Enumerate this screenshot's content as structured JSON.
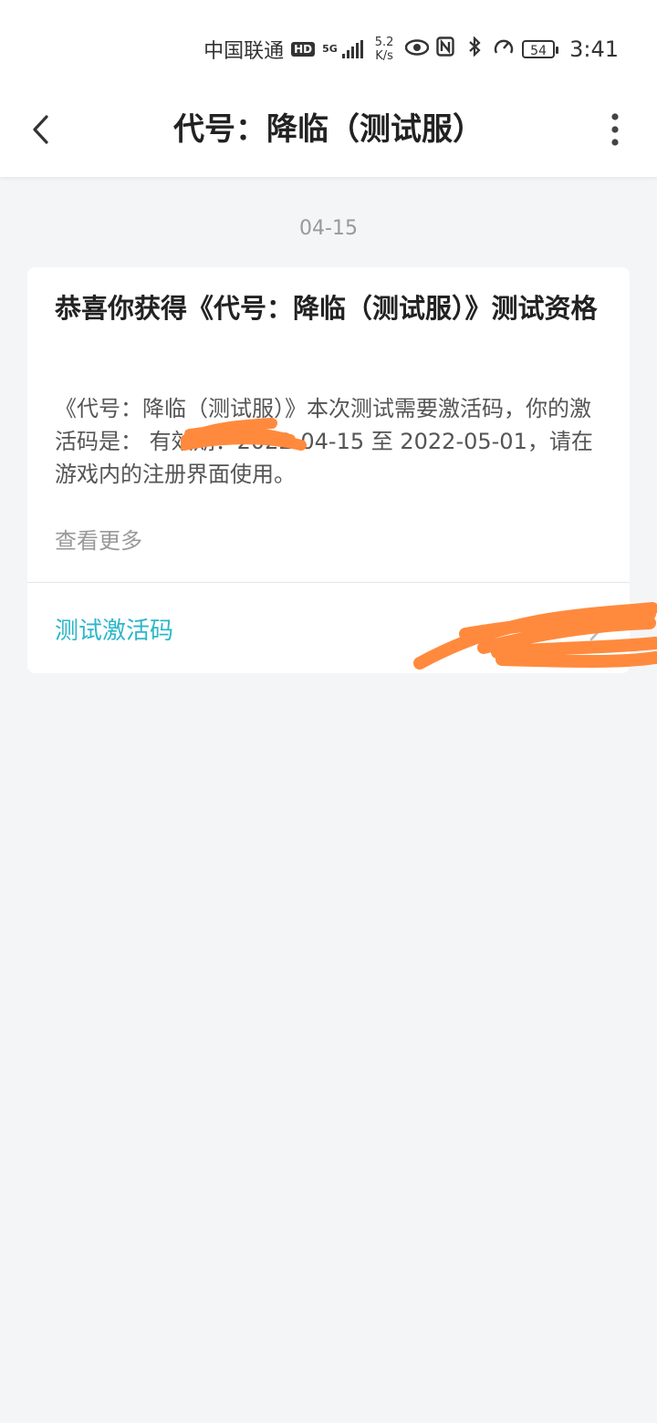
{
  "status_bar": {
    "carrier": "中国联通",
    "hd_badge": "HD",
    "network_type": "5G",
    "speed_value": "5.2",
    "speed_unit": "K/s",
    "battery": "54",
    "time": "3:41"
  },
  "header": {
    "title": "代号：降临（测试服）"
  },
  "date": "04-15",
  "card": {
    "title": "恭喜你获得《代号：降临（测试服）》测试资格",
    "body": "《代号：降临（测试服）》本次测试需要激活码，你的激活码是：            有效期：2022-04-15 至 2022-05-01，请在游戏内的注册界面使用。",
    "more_label": "查看更多",
    "action_label": "测试激活码"
  },
  "colors": {
    "accent": "#2bb7c9",
    "background": "#f4f5f7",
    "redaction": "#ff8a3d"
  }
}
